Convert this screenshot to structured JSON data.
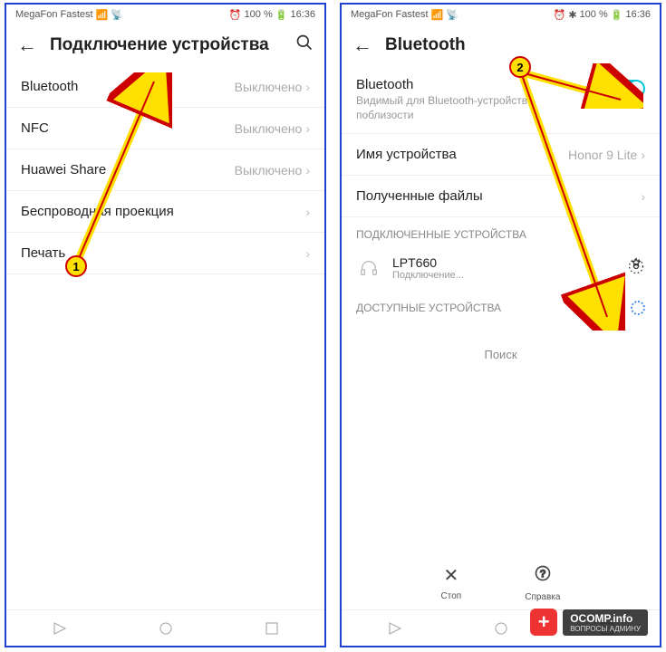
{
  "statusbar": {
    "carrier": "MegaFon Fastest",
    "battery_pct": "100 %",
    "time": "16:36",
    "bt_icon": "✱"
  },
  "screen1": {
    "title": "Подключение устройства",
    "rows": [
      {
        "label": "Bluetooth",
        "value": "Выключено"
      },
      {
        "label": "NFC",
        "value": "Выключено"
      },
      {
        "label": "Huawei Share",
        "value": "Выключено"
      },
      {
        "label": "Беспроводная проекция",
        "value": ""
      },
      {
        "label": "Печать",
        "value": ""
      }
    ]
  },
  "screen2": {
    "title": "Bluetooth",
    "bt_label": "Bluetooth",
    "bt_subtitle": "Видимый для Bluetooth-устройств поблизости",
    "device_name_label": "Имя устройства",
    "device_name_value": "Honor 9 Lite",
    "received_files": "Полученные файлы",
    "connected_header": "ПОДКЛЮЧЕННЫЕ УСТРОЙСТВА",
    "connected_device": {
      "name": "LPT660",
      "status": "Подключение..."
    },
    "available_header": "ДОСТУПНЫЕ УСТРОЙСТВА",
    "searching": "Поиск",
    "stop_label": "Стоп",
    "help_label": "Справка"
  },
  "markers": {
    "m1": "1",
    "m2": "2"
  },
  "watermark": {
    "main": "OCOMP.info",
    "sub": "ВОПРОСЫ АДМИНУ"
  }
}
